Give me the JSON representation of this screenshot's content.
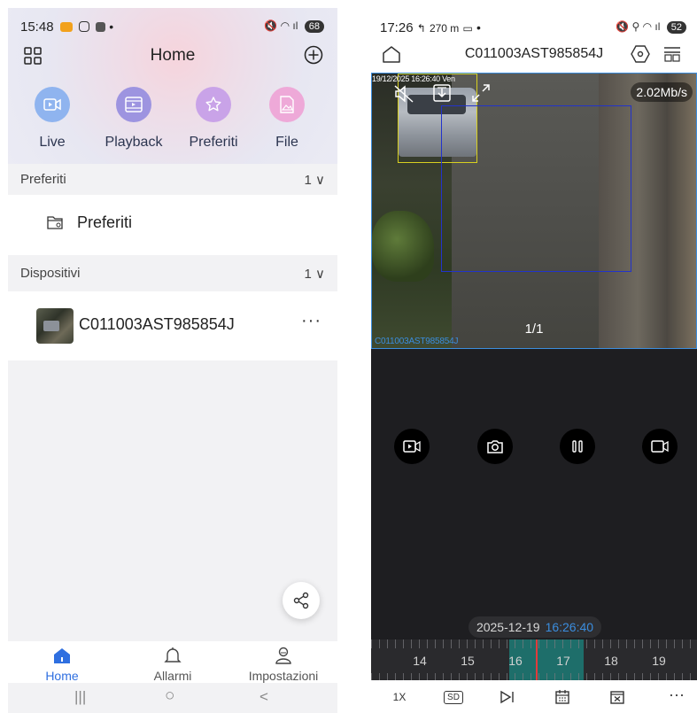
{
  "left": {
    "status": {
      "time": "15:48",
      "battery": "68"
    },
    "header": {
      "title": "Home"
    },
    "quick": [
      {
        "label": "Live",
        "color": "#8fb4ef",
        "icon": "live-video-icon"
      },
      {
        "label": "Playback",
        "color": "#9d94e0",
        "icon": "playback-film-icon"
      },
      {
        "label": "Preferiti",
        "color": "#c9a3e8",
        "icon": "star-icon"
      },
      {
        "label": "File",
        "color": "#eea9d8",
        "icon": "image-file-icon"
      }
    ],
    "favorites_section": {
      "title": "Preferiti",
      "count": "1"
    },
    "favorites_item": "Preferiti",
    "devices_section": {
      "title": "Dispositivi",
      "count": "1"
    },
    "device": {
      "name": "C011003AST985854J",
      "more": "···"
    },
    "tabs": [
      {
        "label": "Home",
        "active": true
      },
      {
        "label": "Allarmi",
        "active": false
      },
      {
        "label": "Impostazioni",
        "active": false
      }
    ],
    "nav": {
      "recent": "|||",
      "home": "○",
      "back": "<"
    },
    "accent": "#2f6fe0"
  },
  "right": {
    "status": {
      "time": "17:26",
      "distance": "270 m",
      "battery": "52"
    },
    "header": {
      "title": "C011003AST985854J"
    },
    "video": {
      "timestamp": "19/12/2025 16:26:40 Ven",
      "bitrate": "2.02Mb/s",
      "page": "1/1",
      "camera_label": "C011003AST985854J"
    },
    "date": "2025-12-19",
    "time": "16:26:40",
    "hours": [
      "14",
      "15",
      "16",
      "17",
      "18",
      "19"
    ],
    "bottom": {
      "speed": "1X",
      "quality": "SD",
      "more": "···"
    },
    "accent": "#3b8dde"
  }
}
